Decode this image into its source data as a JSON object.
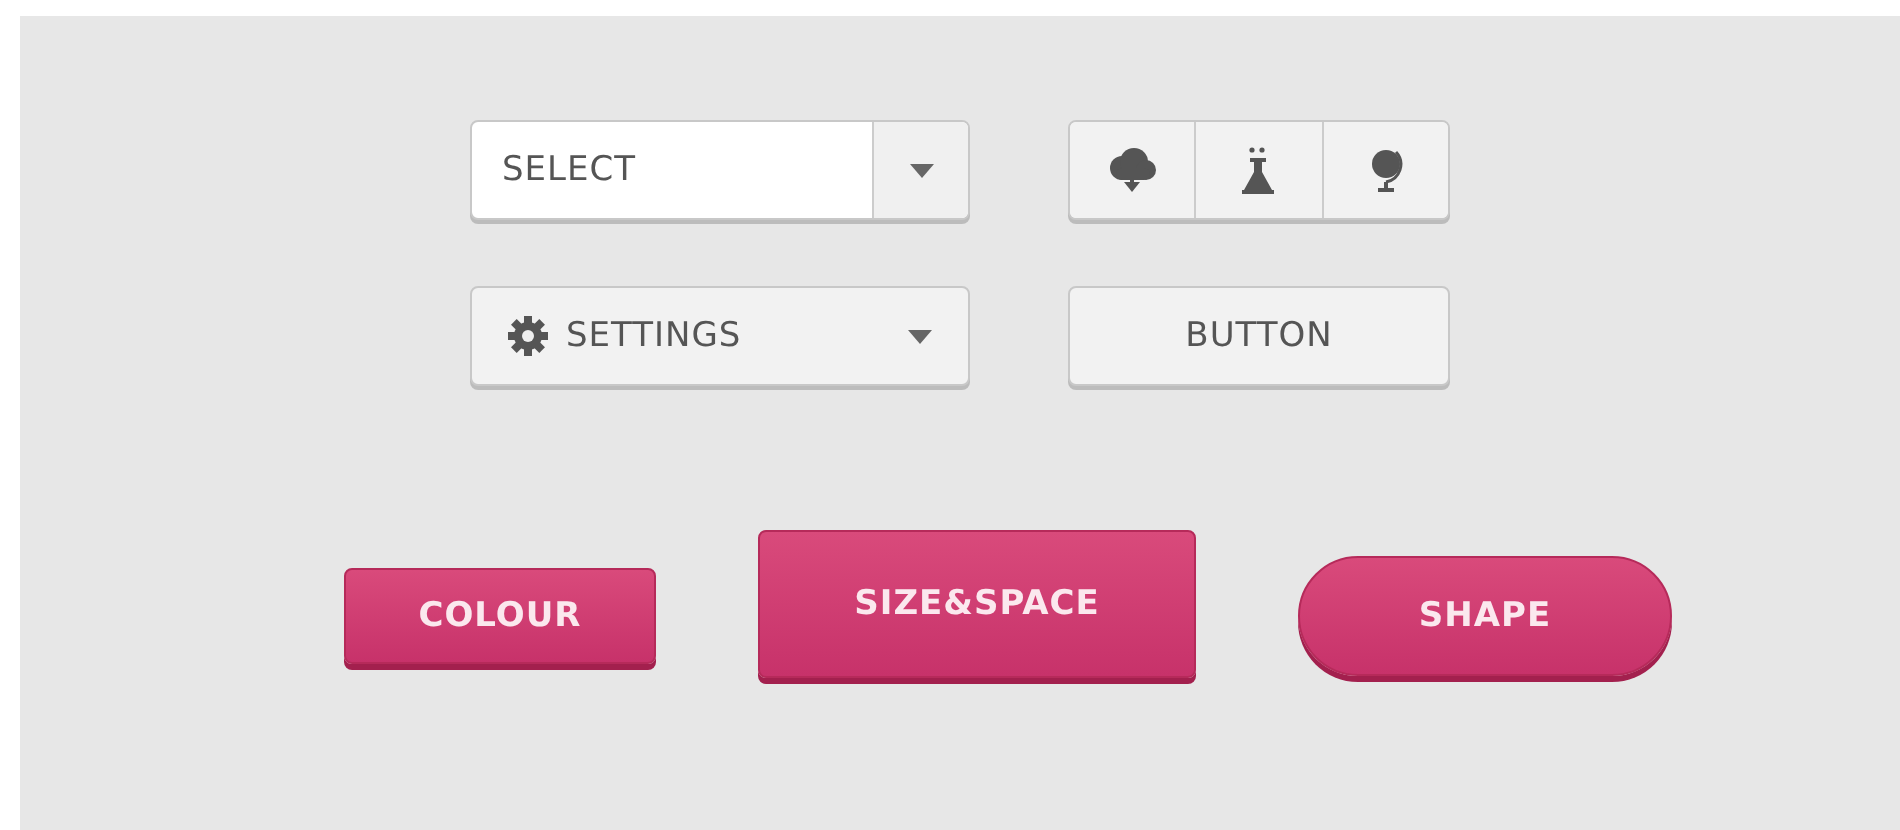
{
  "select": {
    "value": "SELECT"
  },
  "icon_group": [
    {
      "kind": "cloud"
    },
    {
      "kind": "flask"
    },
    {
      "kind": "globe"
    }
  ],
  "settings_menu": {
    "label": "SETTINGS"
  },
  "plain_button": {
    "label": "BUTTON"
  },
  "pink_buttons": [
    {
      "label": "COLOUR",
      "kind": "small"
    },
    {
      "label": "SIZE&SPACE",
      "kind": "large"
    },
    {
      "label": "SHAPE",
      "kind": "pill"
    }
  ]
}
